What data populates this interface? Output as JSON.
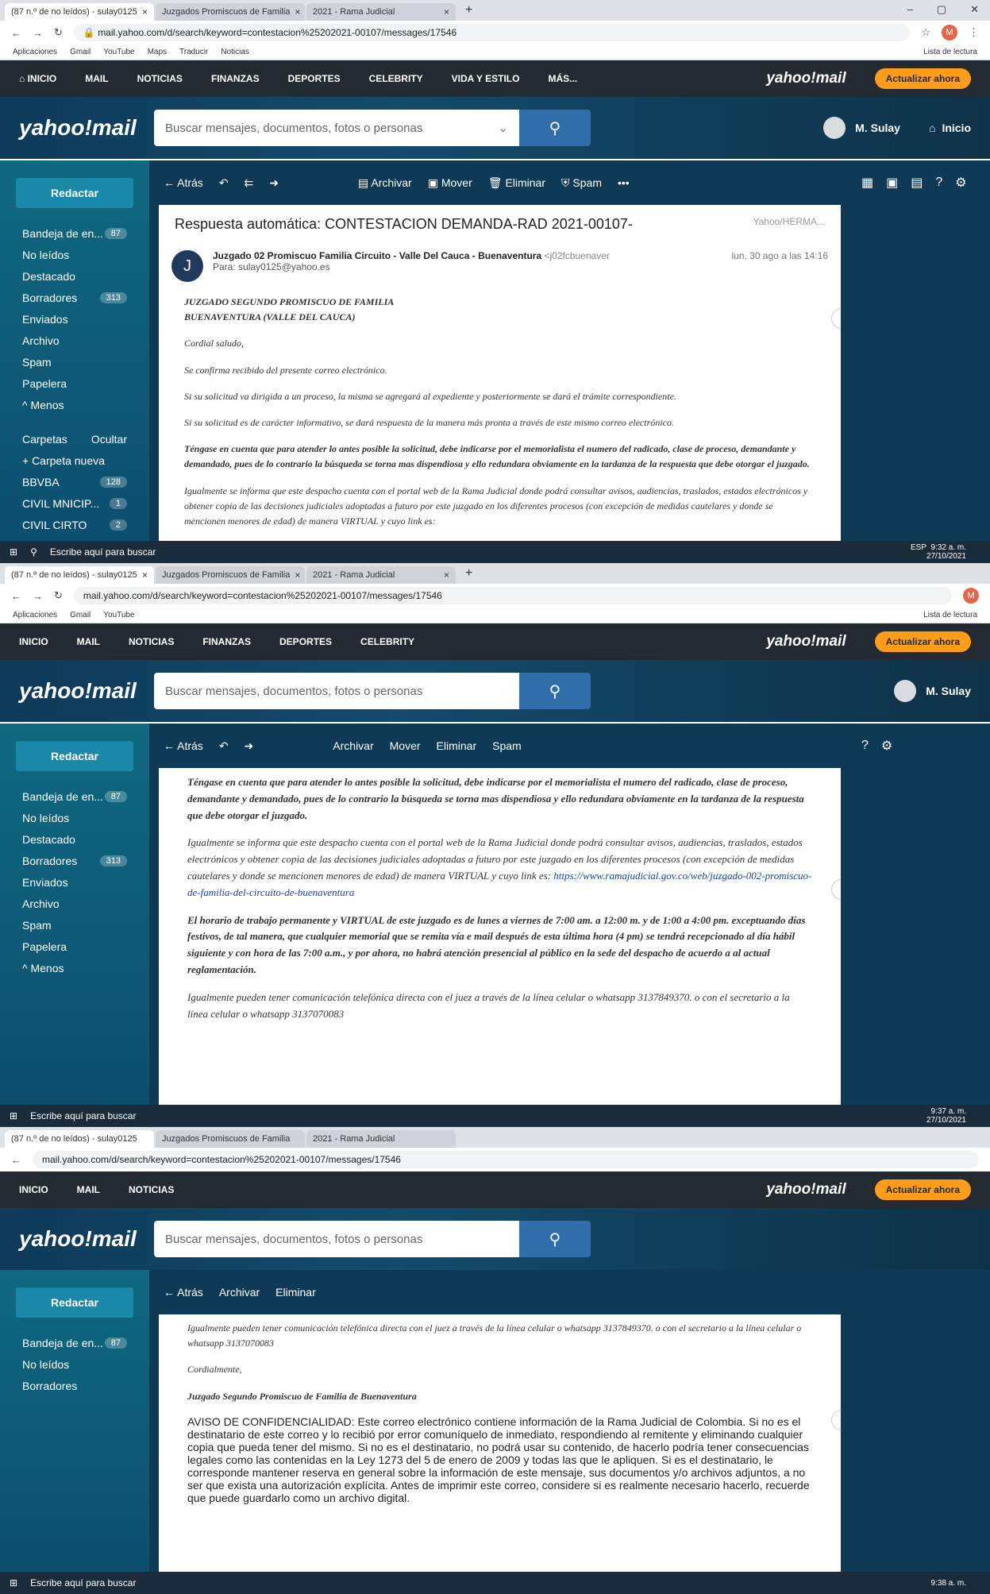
{
  "chrome": {
    "tabs": [
      "(87 n.º de no leídos) - sulay0125",
      "Juzgados Promiscuos de Familia",
      "2021 - Rama Judicial"
    ],
    "url": "mail.yahoo.com/d/search/keyword=contestacion%25202021-00107/messages/17546",
    "bookmarks": [
      "Aplicaciones",
      "Gmail",
      "YouTube",
      "Maps",
      "Traducir",
      "Noticias"
    ],
    "reading_list": "Lista de lectura",
    "profile": "M"
  },
  "nav": {
    "items": [
      "INICIO",
      "MAIL",
      "NOTICIAS",
      "FINANZAS",
      "DEPORTES",
      "CELEBRITY",
      "VIDA Y ESTILO",
      "MÁS..."
    ],
    "brand": "yahoo!mail",
    "upgrade": "Actualizar ahora"
  },
  "header": {
    "logo": "yahoo!mail",
    "search_placeholder": "Buscar mensajes, documentos, fotos o personas",
    "user": "M. Sulay",
    "home": "Inicio"
  },
  "sidebar": {
    "compose": "Redactar",
    "folders": [
      {
        "label": "Bandeja de en...",
        "badge": "87"
      },
      {
        "label": "No leídos",
        "badge": ""
      },
      {
        "label": "Destacado",
        "badge": ""
      },
      {
        "label": "Borradores",
        "badge": "313"
      },
      {
        "label": "Enviados",
        "badge": ""
      },
      {
        "label": "Archivo",
        "badge": ""
      },
      {
        "label": "Spam",
        "badge": ""
      },
      {
        "label": "Papelera",
        "badge": ""
      },
      {
        "label": "^ Menos",
        "badge": ""
      }
    ],
    "folders_heading": "Carpetas",
    "hide": "Ocultar",
    "new_folder": "+ Carpeta nueva",
    "custom": [
      {
        "label": "BBVBA",
        "badge": "128"
      },
      {
        "label": "CIVIL MNICIP...",
        "badge": "1"
      },
      {
        "label": "CIVIL CIRTO",
        "badge": "2"
      }
    ]
  },
  "toolbar": {
    "back": "Atrás",
    "archive": "Archivar",
    "move": "Mover",
    "delete": "Eliminar",
    "spam": "Spam"
  },
  "message": {
    "subject": "Respuesta automática: CONTESTACION DEMANDA-RAD 2021-00107-",
    "folder_label": "Yahoo/HERMA...",
    "sender": "Juzgado 02 Promiscuo Familia Circuito - Valle Del Cauca - Buenaventura",
    "sender_email": "<j02fcbuenaver",
    "to": "Para: sulay0125@yahoo.es",
    "date": "lun, 30 ago a las 14:16",
    "org1": "JUZGADO SEGUNDO PROMISCUO DE FAMILIA",
    "org2": "BUENAVENTURA (VALLE DEL CAUCA)",
    "p1": "Cordial saludo,",
    "p2": "Se confirma recibido del presente correo electrónico.",
    "p3": "Si su solicitud va dirigida a un proceso, la misma se agregará al expediente y posteriormente se dará el trámite correspondiente.",
    "p4": "Si su solicitud es de carácter informativo, se dará respuesta de la manera más pronta a través de este mismo correo electrónico.",
    "p5": "Téngase en cuenta que para atender lo antes posible la solicitud, debe indicarse por el memorialista el numero del radicado, clase de proceso, demandante y demandado, pues de lo contrario la búsqueda se torna mas dispendiosa y ello redundara obviamente en la tardanza de la respuesta que debe otorgar el juzgado.",
    "p6": "Igualmente se informa que este despacho cuenta con el portal web de la Rama Judicial donde podrá consultar avisos, audiencias, traslados, estados electrónicos y obtener copia de las decisiones judiciales adoptadas a futuro por este juzgado en los diferentes procesos (con excepción de medidas cautelares y donde se mencionen menores de edad) de manera VIRTUAL y cuyo link es:",
    "link": "https://www.ramajudicial.gov.co/web/juzgado-002-promiscuo-de-familia-del-circuito-de-buenaventura",
    "p7": "El horario de trabajo permanente y VIRTUAL de este juzgado es de lunes a viernes de 7:00 am. a 12:00 m. y de 1:00 a 4:00 pm. exceptuando días festivos, de tal manera, que cualquier memorial que se remita vía e mail después de esta última hora (4 pm) se tendrá recepcionado al día hábil siguiente y con hora de las 7:00 a.m., y por ahora, no habrá atención presencial al público en la sede del despacho de acuerdo a al actual reglamentación.",
    "p8": "Igualmente pueden tener comunicación telefónica directa con el juez a través de la línea celular o whatsapp 3137849370. o con el secretario a la línea celular o whatsapp 3137070083",
    "closing": "Cordialmente,",
    "signature": "Juzgado Segundo Promiscuo de Familia de Buenaventura",
    "confidential": "AVISO DE CONFIDENCIALIDAD: Este correo electrónico contiene información de la Rama Judicial de Colombia. Si no es el destinatario de este correo y lo recibió por error comuníquelo de inmediato, respondiendo al remitente y eliminando cualquier copia que pueda tener del mismo. Si no es el destinatario, no podrá usar su contenido, de hacerlo podría tener consecuencias legales como las contenidas en la Ley 1273 del 5 de enero de 2009 y todas las que le apliquen. Si es el destinatario, le corresponde mantener reserva en general sobre la información de este mensaje, sus documentos y/o archivos adjuntos, a no ser que exista una autorización explícita. Antes de imprimir este correo, considere si es realmente necesario hacerlo, recuerde que puede guardarlo como un archivo digital."
  },
  "taskbar": {
    "search": "Escribe aquí para buscar",
    "lang": "ESP",
    "times": [
      "9:32 a. m.",
      "9:37 a. m.",
      "9:38 a. m."
    ],
    "date": "27/10/2021"
  }
}
